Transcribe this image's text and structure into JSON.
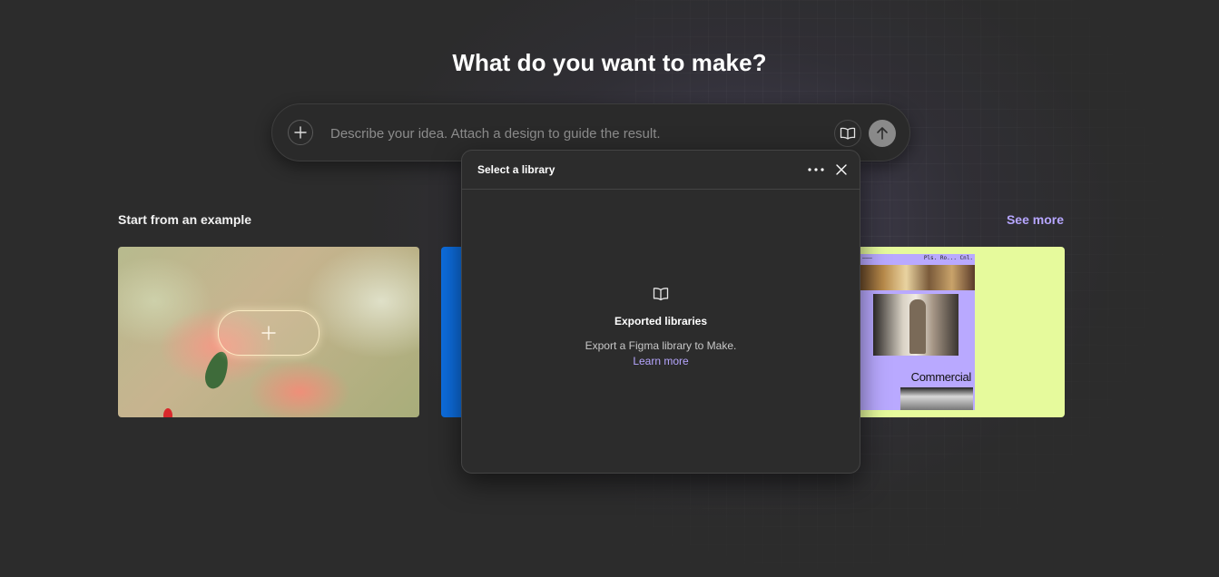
{
  "headline": "What do you want to make?",
  "prompt": {
    "placeholder": "Describe your idea. Attach a design to guide the result.",
    "value": ""
  },
  "examples": {
    "title": "Start from an example",
    "see_more": "See more",
    "cards": [
      {
        "name": "flower-photo-example"
      },
      {
        "name": "blue-example"
      },
      {
        "name": "poster-example",
        "poster_top_left": "———",
        "poster_top_right": "Pls. Ro... Cnl.",
        "poster_word": "Commercial"
      }
    ]
  },
  "popover": {
    "title": "Select a library",
    "empty_title": "Exported libraries",
    "empty_desc_prefix": "Export a Figma library to Make.",
    "learn_more": "Learn more"
  },
  "icons": {
    "attach": "plus-icon",
    "library": "book-icon",
    "send": "arrow-up-icon",
    "more": "more-horizontal-icon",
    "close": "close-icon",
    "empty": "book-icon"
  },
  "colors": {
    "background": "#2c2c2c",
    "accent_link": "#b6a6ff",
    "card_blue": "#0d6ee0",
    "card_lime": "#e6fa9c",
    "poster_lavender": "#b9a9ff"
  }
}
